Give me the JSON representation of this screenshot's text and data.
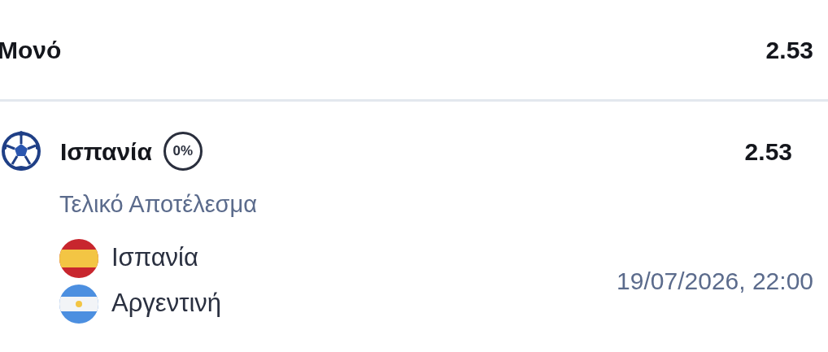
{
  "bet_type": {
    "label": "Μονό",
    "odds": "2.53"
  },
  "selection": {
    "name": "Ισπανία",
    "badge": "0%",
    "odds": "2.53",
    "market": "Τελικό Αποτέλεσμα",
    "teams": [
      {
        "name": "Ισπανία"
      },
      {
        "name": "Αργεντινή"
      }
    ],
    "datetime": "19/07/2026, 22:00"
  }
}
